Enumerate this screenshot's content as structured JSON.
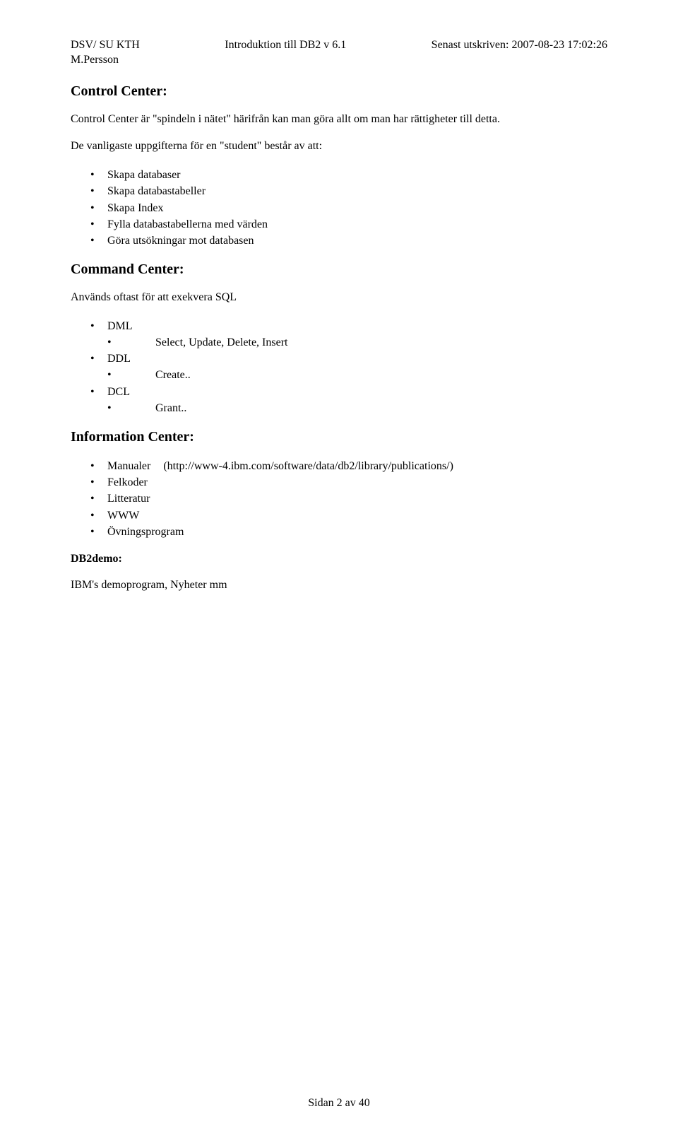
{
  "header": {
    "left_line1": "DSV/ SU KTH",
    "left_line2": "M.Persson",
    "center": "Introduktion till DB2 v 6.1",
    "right": "Senast utskriven: 2007-08-23 17:02:26"
  },
  "s1": {
    "heading": "Control Center:",
    "para": "Control Center är \"spindeln i nätet\" härifrån kan man göra allt om man har rättigheter till detta.",
    "intro": "De vanligaste uppgifterna för en \"student\" består av att:",
    "bullets": {
      "b1": "Skapa databaser",
      "b2": "Skapa databastabeller",
      "b3": "Skapa Index",
      "b4": "Fylla databastabellerna med värden",
      "b5": "Göra utsökningar mot databasen"
    }
  },
  "s2": {
    "heading": "Command Center:",
    "para": "Används oftast för att exekvera SQL",
    "items": {
      "dml": "DML",
      "dml_sub": "Select, Update, Delete, Insert",
      "ddl": "DDL",
      "ddl_sub": "Create..",
      "dcl": "DCL",
      "dcl_sub": "Grant.."
    }
  },
  "s3": {
    "heading": "Information Center:",
    "items": {
      "manualer": "Manualer",
      "manualer_url": "(http://www-4.ibm.com/software/data/db2/library/publications/)",
      "felkoder": "Felkoder",
      "litteratur": "Litteratur",
      "www": "WWW",
      "ovning": "Övningsprogram"
    }
  },
  "s4": {
    "heading": "DB2demo:",
    "para": "IBM's demoprogram, Nyheter mm"
  },
  "footer": "Sidan 2 av 40"
}
